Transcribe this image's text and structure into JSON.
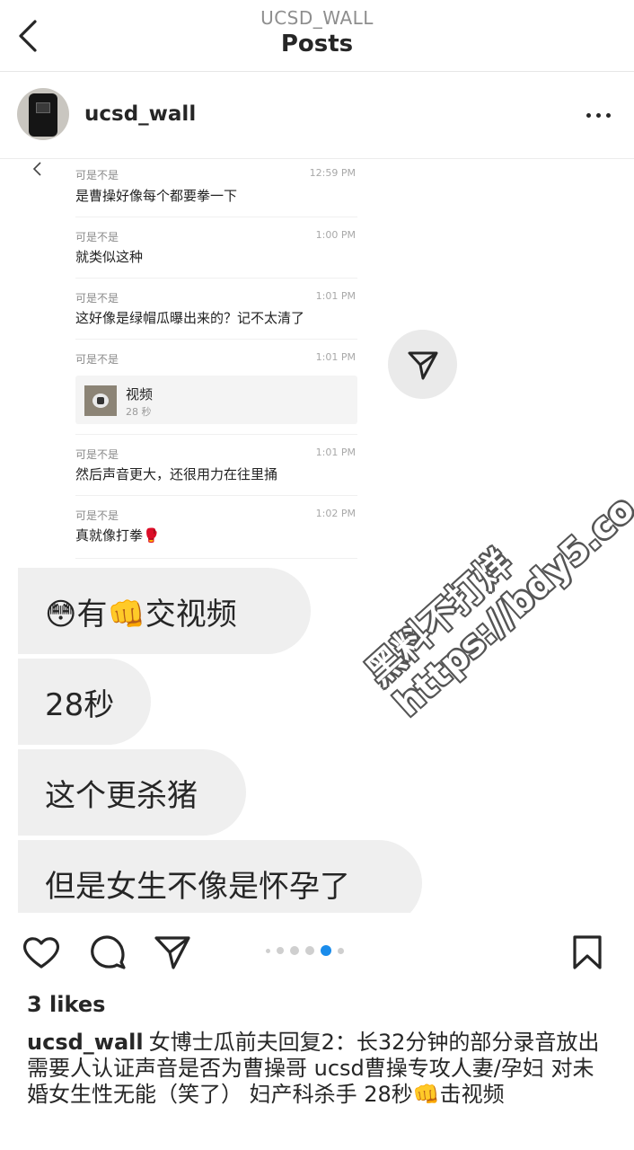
{
  "header": {
    "subtitle": "UCSD_WALL",
    "title": "Posts"
  },
  "author": {
    "username": "ucsd_wall"
  },
  "chat": {
    "messages": [
      {
        "sender": "可是不是",
        "time": "12:59 PM",
        "text": "是曹操好像每个都要拳一下"
      },
      {
        "sender": "可是不是",
        "time": "1:00 PM",
        "text": "就类似这种"
      },
      {
        "sender": "可是不是",
        "time": "1:01 PM",
        "text": "这好像是绿帽瓜曝出来的？记不太清了"
      },
      {
        "sender": "可是不是",
        "time": "1:01 PM",
        "video_title": "视频",
        "video_duration": "28 秒"
      },
      {
        "sender": "可是不是",
        "time": "1:01 PM",
        "text": "然后声音更大，还很用力在往里捅"
      },
      {
        "sender": "可是不是",
        "time": "1:02 PM",
        "text": "真就像打拳🥊"
      }
    ]
  },
  "bubbles": [
    {
      "text": "😳有👊交视频"
    },
    {
      "text": "28秒"
    },
    {
      "text": "这个更杀猪"
    },
    {
      "text": "但是女生不像是怀孕了"
    }
  ],
  "watermark": {
    "line1": "黑料不打烊",
    "line2": "https://bdy5.co"
  },
  "carousel": {
    "count": 6,
    "active_index": 4
  },
  "post": {
    "likes": "3 likes",
    "caption_user": "ucsd_wall",
    "caption_text": "女博士瓜前夫回复2：长32分钟的部分录音放出 需要人认证声音是否为曹操哥 ucsd曹操专攻人妻/孕妇 对未婚女生性无能（笑了） 妇产科杀手 28秒👊击视频"
  },
  "colors": {
    "text": "#262626",
    "muted": "#8e8e8e",
    "bubble": "#efefef",
    "active_dot": "#1a8ceb"
  }
}
